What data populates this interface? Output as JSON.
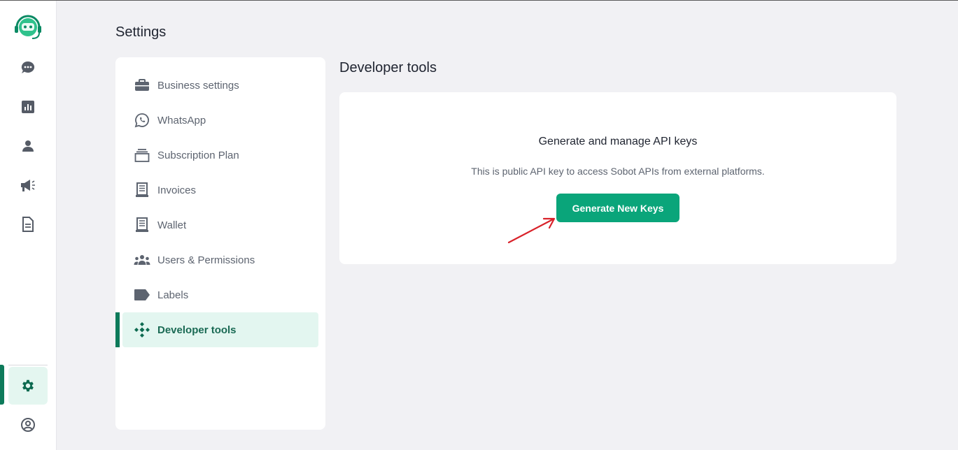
{
  "app": {
    "page_title": "Settings"
  },
  "colors": {
    "brand": "#0aa57a",
    "active_bg": "#e3f6f0",
    "annotation_arrow": "#d9222a"
  },
  "rail": {
    "items": [
      {
        "icon": "chat-icon"
      },
      {
        "icon": "analytics-icon"
      },
      {
        "icon": "contacts-icon"
      },
      {
        "icon": "campaign-megaphone-icon"
      },
      {
        "icon": "document-icon"
      },
      {
        "icon": "settings-gear-icon",
        "active": true
      },
      {
        "icon": "profile-icon"
      }
    ]
  },
  "menu": {
    "items": [
      {
        "label": "Business settings",
        "icon": "briefcase-icon"
      },
      {
        "label": "WhatsApp",
        "icon": "whatsapp-icon"
      },
      {
        "label": "Subscription Plan",
        "icon": "stack-icon"
      },
      {
        "label": "Invoices",
        "icon": "receipt-icon"
      },
      {
        "label": "Wallet",
        "icon": "receipt-icon"
      },
      {
        "label": "Users & Permissions",
        "icon": "users-icon"
      },
      {
        "label": "Labels",
        "icon": "label-tag-icon"
      },
      {
        "label": "Developer tools",
        "icon": "developer-tools-icon",
        "active": true
      }
    ]
  },
  "developer_tools": {
    "title": "Developer tools",
    "heading": "Generate and manage API keys",
    "description": "This is public API key to access Sobot APIs from external platforms.",
    "button_label": "Generate New Keys"
  }
}
